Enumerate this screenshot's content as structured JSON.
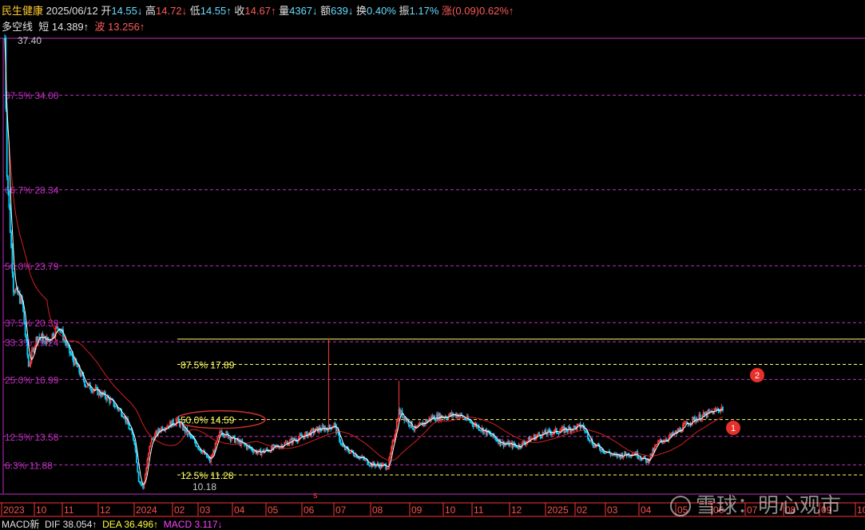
{
  "header": {
    "name": "民生健康",
    "date": "2025/06/12",
    "open_label": "开",
    "open": "14.55↓",
    "high_label": "高",
    "high": "14.72↓",
    "low_label": "低",
    "low": "14.55↑",
    "close_label": "收",
    "close": "14.67↑",
    "vol_label": "量",
    "vol": "4367↓",
    "amt_label": "额",
    "amt": "639↓",
    "turn_label": "换",
    "turn": "0.40%",
    "amp_label": "振",
    "amp": "1.17%",
    "chg_label": "涨",
    "chg": "(0.09)",
    "chg_pct": "0.62%↑"
  },
  "indicator": {
    "name": "多空线",
    "short_label": "短",
    "short_val": "14.389↑",
    "wave_label": "波",
    "wave_val": "13.256↑"
  },
  "macd": {
    "name": "MACD新",
    "dif": "DIF 38.054↑",
    "dea": "DEA 36.496↑",
    "macd": "MACD 3.117↓"
  },
  "watermark": "雪球：明心观市",
  "colors": {
    "bg": "#000000",
    "up": "#ff3b3b",
    "down": "#00d2ff",
    "ma_white": "#ffffff",
    "ma_red": "#d42020",
    "fib_major": "#c030c0",
    "fib_minor": "#ffff66",
    "axis": "#ff3333"
  },
  "chart_data": {
    "type": "candlestick",
    "y_max_label": "37.40",
    "fib_major": [
      {
        "label": "87.5% 34.00",
        "value": 34.0
      },
      {
        "label": "66.7% 28.34",
        "value": 28.34
      },
      {
        "label": "50.0% 23.79",
        "value": 23.79
      },
      {
        "label": "37.5% 20.39",
        "value": 20.39
      },
      {
        "label": "33.3% 19.24",
        "value": 19.24
      },
      {
        "label": "25.0% 16.99",
        "value": 16.99
      },
      {
        "label": "12.5% 13.58",
        "value": 13.58
      },
      {
        "label": "6.3% 11.88",
        "value": 11.88
      }
    ],
    "fib_minor": [
      {
        "label": "87.5% 17.89",
        "value": 17.89
      },
      {
        "label": "50.0% 14.59",
        "value": 14.59
      },
      {
        "label": "12.5% 11.28",
        "value": 11.28
      }
    ],
    "low_label": "10.18",
    "x_labels": [
      "2023",
      "10",
      "11",
      "12",
      "2024",
      "02",
      "03",
      "04",
      "05",
      "06",
      "07",
      "08",
      "09",
      "10",
      "11",
      "12",
      "2025",
      "02",
      "03",
      "04",
      "05",
      "06",
      "07",
      "08",
      "09",
      "10"
    ],
    "markers": [
      "1",
      "2"
    ],
    "keypoints": [
      [
        0,
        37.4
      ],
      [
        2,
        29.5
      ],
      [
        8,
        22.5
      ],
      [
        16,
        21.6
      ],
      [
        22,
        17.8
      ],
      [
        30,
        19.6
      ],
      [
        40,
        19.3
      ],
      [
        50,
        20.2
      ],
      [
        60,
        18.6
      ],
      [
        75,
        16.7
      ],
      [
        95,
        15.9
      ],
      [
        110,
        14.9
      ],
      [
        120,
        13.3
      ],
      [
        124,
        11.0
      ],
      [
        128,
        10.5
      ],
      [
        135,
        13.3
      ],
      [
        145,
        14.1
      ],
      [
        160,
        14.5
      ],
      [
        175,
        13.3
      ],
      [
        190,
        12.1
      ],
      [
        200,
        13.9
      ],
      [
        215,
        13.3
      ],
      [
        235,
        12.6
      ],
      [
        250,
        12.9
      ],
      [
        265,
        13.3
      ],
      [
        280,
        13.7
      ],
      [
        290,
        14.0
      ],
      [
        300,
        14.1
      ],
      [
        305,
        14.3
      ],
      [
        313,
        12.9
      ],
      [
        325,
        12.5
      ],
      [
        340,
        11.9
      ],
      [
        355,
        11.8
      ],
      [
        365,
        15.1
      ],
      [
        380,
        14.0
      ],
      [
        395,
        14.7
      ],
      [
        420,
        14.9
      ],
      [
        440,
        14.1
      ],
      [
        460,
        13.2
      ],
      [
        475,
        13.0
      ],
      [
        495,
        13.7
      ],
      [
        520,
        14.0
      ],
      [
        535,
        14.2
      ],
      [
        545,
        13.1
      ],
      [
        565,
        12.4
      ],
      [
        583,
        12.6
      ],
      [
        595,
        12.1
      ],
      [
        605,
        13.2
      ],
      [
        620,
        13.7
      ],
      [
        635,
        14.5
      ],
      [
        650,
        14.9
      ],
      [
        665,
        15.3
      ]
    ],
    "spikes": [
      [
        300,
        19.3
      ],
      [
        365,
        16.8
      ]
    ]
  }
}
